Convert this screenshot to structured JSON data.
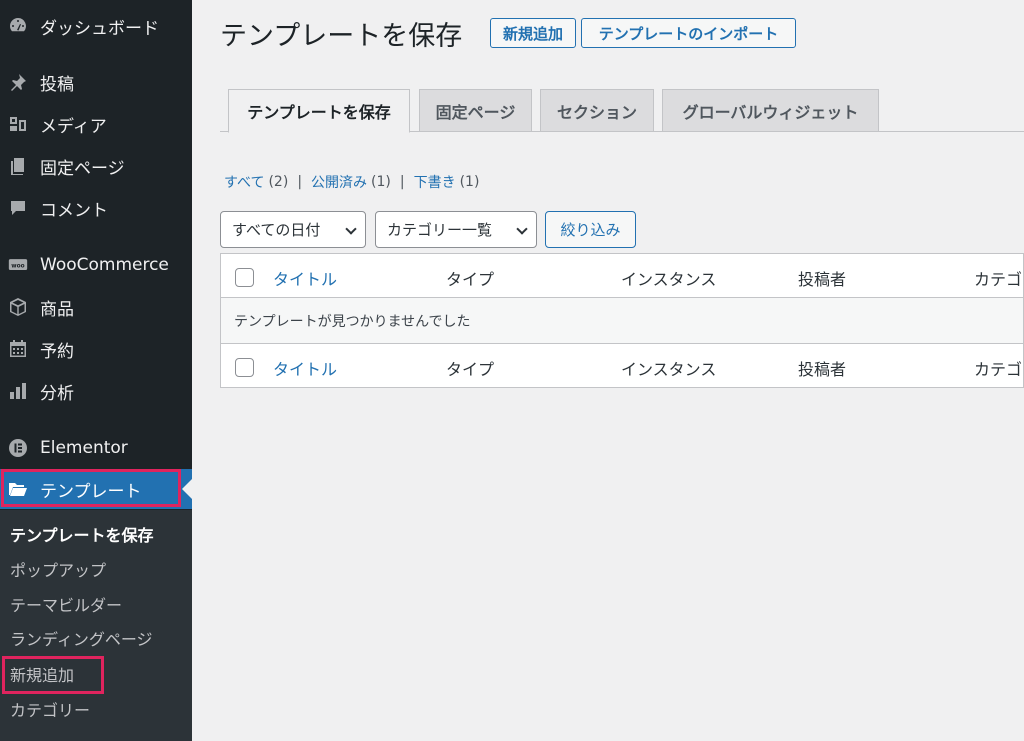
{
  "sidebar": {
    "items": [
      {
        "name": "dashboard",
        "label": "ダッシュボード",
        "icon": "dashboard-icon"
      },
      {
        "name": "posts",
        "label": "投稿",
        "icon": "pin-icon"
      },
      {
        "name": "media",
        "label": "メディア",
        "icon": "media-icon"
      },
      {
        "name": "pages",
        "label": "固定ページ",
        "icon": "page-icon"
      },
      {
        "name": "comments",
        "label": "コメント",
        "icon": "comment-icon"
      },
      {
        "name": "woocommerce",
        "label": "WooCommerce",
        "icon": "woo-icon"
      },
      {
        "name": "products",
        "label": "商品",
        "icon": "box-icon"
      },
      {
        "name": "bookings",
        "label": "予約",
        "icon": "calendar-icon"
      },
      {
        "name": "analytics",
        "label": "分析",
        "icon": "bar-chart-icon"
      },
      {
        "name": "elementor",
        "label": "Elementor",
        "icon": "elementor-icon"
      },
      {
        "name": "templates",
        "label": "テンプレート",
        "icon": "folder-open-icon"
      }
    ],
    "submenu": [
      {
        "name": "saved-templates",
        "label": "テンプレートを保存"
      },
      {
        "name": "popups",
        "label": "ポップアップ"
      },
      {
        "name": "theme-builder",
        "label": "テーマビルダー"
      },
      {
        "name": "landing-pages",
        "label": "ランディングページ"
      },
      {
        "name": "add-new",
        "label": "新規追加"
      },
      {
        "name": "categories",
        "label": "カテゴリー"
      }
    ],
    "highlight_color": "#e0245e",
    "active_color": "#2271b1"
  },
  "header": {
    "title": "テンプレートを保存",
    "add_new_label": "新規追加",
    "import_label": "テンプレートのインポート"
  },
  "tabs": [
    {
      "label": "テンプレートを保存",
      "active": true
    },
    {
      "label": "固定ページ",
      "active": false
    },
    {
      "label": "セクション",
      "active": false
    },
    {
      "label": "グローバルウィジェット",
      "active": false
    }
  ],
  "views": [
    {
      "label": "すべて",
      "count": "(2)"
    },
    {
      "label": "公開済み",
      "count": "(1)"
    },
    {
      "label": "下書き",
      "count": "(1)"
    }
  ],
  "filters": {
    "date_select": "すべての日付",
    "category_select": "カテゴリー一覧",
    "filter_button": "絞り込み"
  },
  "table": {
    "columns": [
      "タイトル",
      "タイプ",
      "インスタンス",
      "投稿者",
      "カテゴリー"
    ],
    "empty_message": "テンプレートが見つかりませんでした"
  }
}
